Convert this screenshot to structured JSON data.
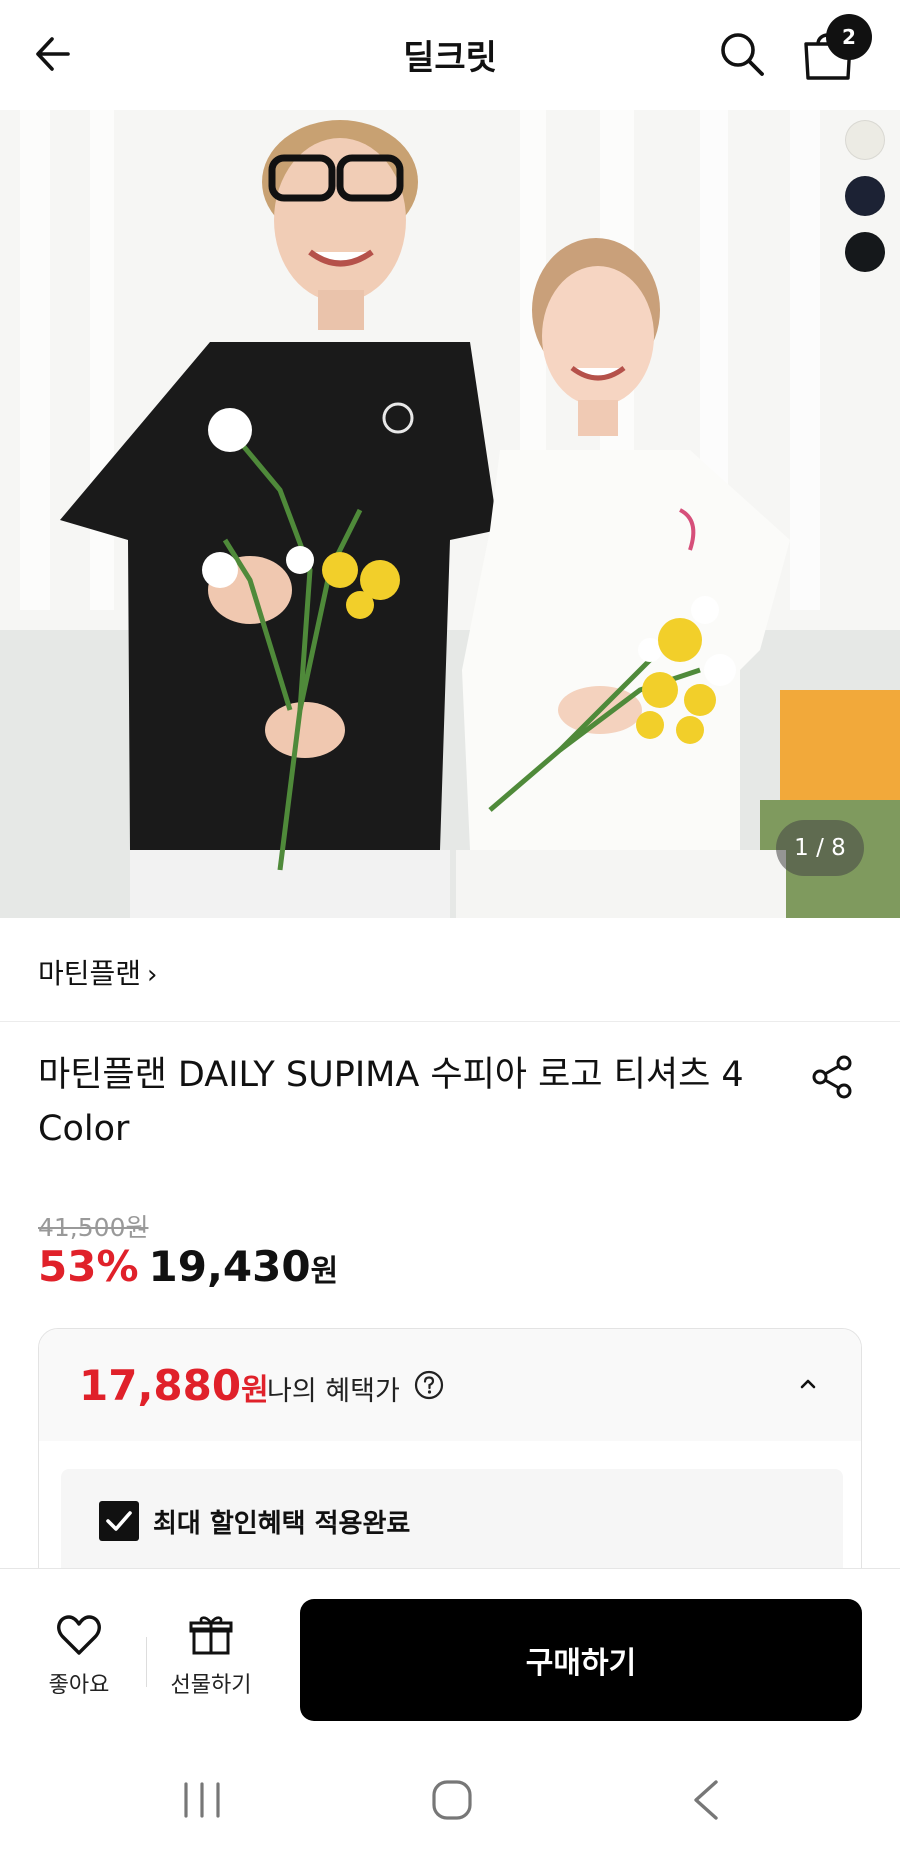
{
  "header": {
    "title": "딜크릿",
    "cart_count": "2"
  },
  "hero": {
    "image_counter": "1 / 8",
    "swatches": [
      "#ecebe4",
      "#1c2234",
      "#15181b"
    ]
  },
  "product": {
    "brand": "마틴플랜",
    "brand_chevron": "›",
    "title": "마틴플랜 DAILY SUPIMA 수피아 로고 티셔츠 4 Color",
    "original_price": "41,500원",
    "discount_rate": "53%",
    "sale_price": "19,430",
    "sale_price_unit": "원"
  },
  "benefit": {
    "price": "17,880",
    "price_unit": "원",
    "label": "나의 혜택가",
    "check_label": "최대 할인혜택 적용완료"
  },
  "action_bar": {
    "like_label": "좋아요",
    "gift_label": "선물하기",
    "buy_label": "구매하기"
  },
  "colors": {
    "accent_red": "#e0212a",
    "primary_black": "#000000"
  }
}
